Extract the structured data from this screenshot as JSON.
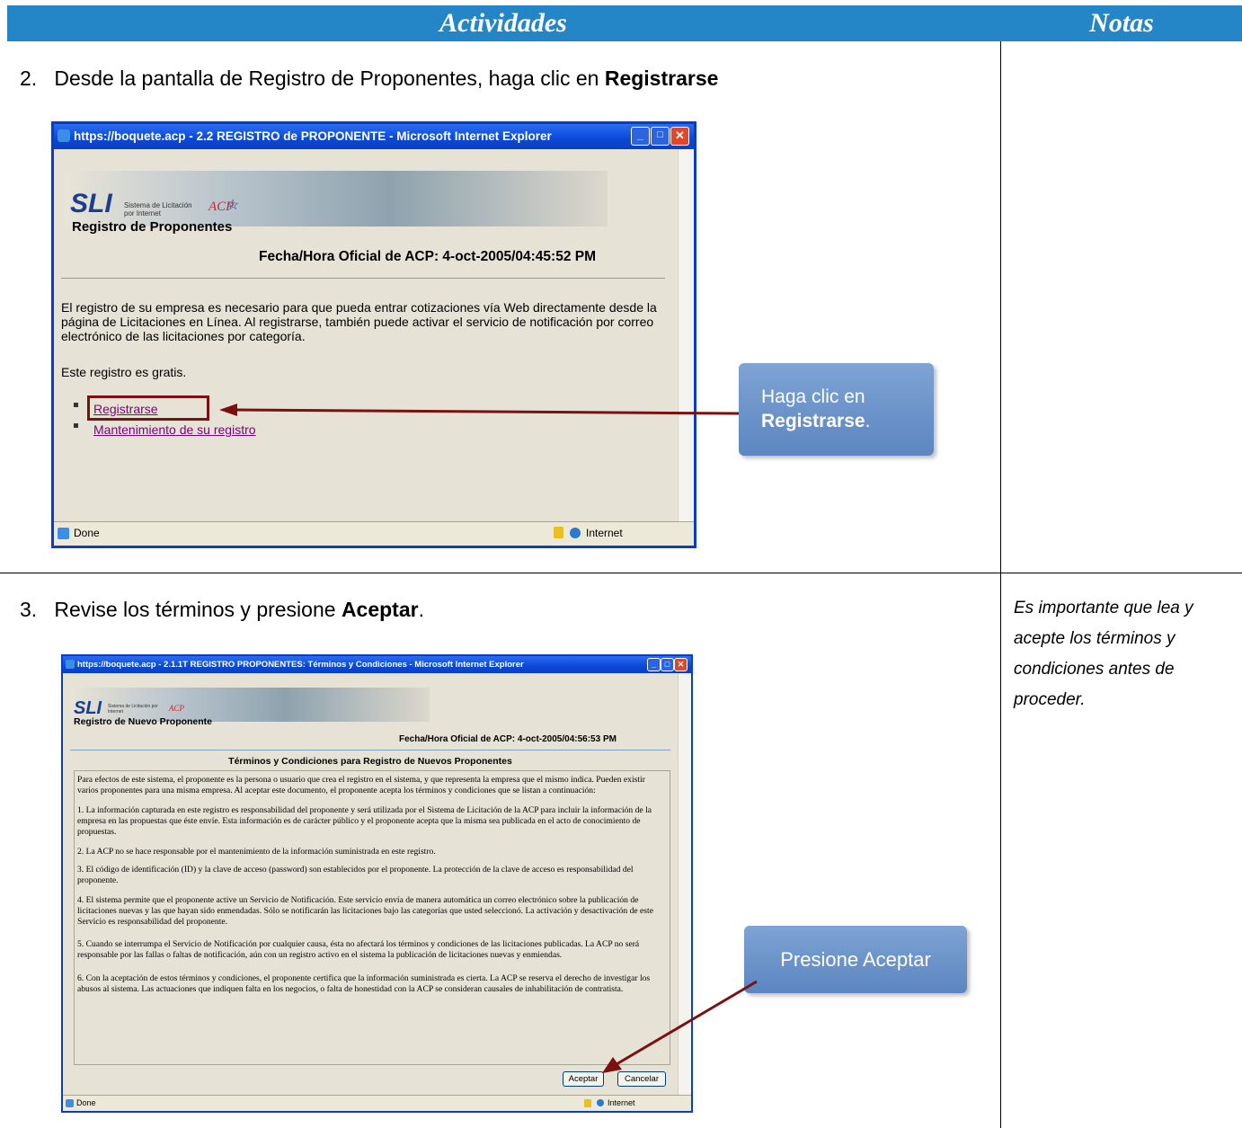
{
  "header": {
    "activities": "Actividades",
    "notes": "Notas"
  },
  "step2": {
    "number": "2.",
    "text": "Desde la pantalla de Registro de Proponentes, haga clic en ",
    "bold": "Registrarse",
    "window": {
      "title": "https://boquete.acp - 2.2 REGISTRO de PROPONENTE - Microsoft Internet Explorer",
      "logo": "SLI",
      "logo_sub": "Sistema de Licitación por Internet",
      "acp": "ACP",
      "page_title": "Registro de Proponentes",
      "datetime": "Fecha/Hora Oficial de ACP: 4-oct-2005/04:45:52 PM",
      "paragraph": "El registro de su empresa es necesario para que pueda entrar cotizaciones vía Web directamente desde la página de Licitaciones en Línea. Al registrarse, también puede activar el servicio de notificación por correo electrónico de las licitaciones por categoría.",
      "free": "Este registro es gratis.",
      "link1": "Registrarse",
      "link2": "Mantenimiento de su registro",
      "status": "Done",
      "zone": "Internet"
    },
    "callout_line1": "Haga clic en",
    "callout_bold": "Registrarse",
    "callout_end": "."
  },
  "step3": {
    "number": "3.",
    "text": "Revise los términos y presione ",
    "bold": "Aceptar",
    "end": ".",
    "window": {
      "title": "https://boquete.acp - 2.1.1T REGISTRO PROPONENTES: Términos y Condiciones - Microsoft Internet Explorer",
      "logo": "SLI",
      "logo_sub": "Sistema de Licitación por Internet",
      "acp": "ACP",
      "page_title": "Registro de Nuevo Proponente",
      "datetime": "Fecha/Hora Oficial de ACP: 4-oct-2005/04:56:53 PM",
      "terms_title": "Términos y Condiciones para Registro de Nuevos Proponentes",
      "intro": "Para efectos de este sistema, el proponente es la persona o usuario que crea el registro en el sistema, y que representa la empresa que el mismo indica. Pueden existir varios proponentes para una misma empresa. Al aceptar este documento, el proponente acepta los términos y condiciones que se listan a continuación:",
      "t1": "1. La información capturada en este registro es responsabilidad del proponente y será utilizada por el Sistema de Licitación de la ACP para incluir la información de la empresa en las propuestas que éste envíe. Esta información es de carácter público y el proponente acepta que la misma sea publicada en el acto de conocimiento de propuestas.",
      "t2": "2. La ACP no se hace responsable por el mantenimiento de la información suministrada en este registro.",
      "t3": "3. El código de identificación (ID) y la clave de acceso (password) son establecidos por el proponente. La protección de la clave de acceso es responsabilidad del proponente.",
      "t4": "4. El sistema permite que el proponente active un Servicio de Notificación. Este servicio envía de manera automática un correo electrónico sobre la publicación de licitaciones nuevas y las que hayan sido enmendadas. Sólo se notificarán las licitaciones bajo las categorías que usted seleccionó. La activación y desactivación de este Servicio es responsabilidad del proponente.",
      "t5": "5. Cuando se interrumpa el Servicio de Notificación por cualquier causa, ésta no afectará los términos y condiciones de las licitaciones publicadas. La ACP no será responsable por las fallas o faltas de notificación, aún con un registro activo en el sistema la publicación de licitaciones nuevas y enmiendas.",
      "t6": "6. Con la aceptación de estos términos y condiciones, el proponente certifica que la información suministrada es cierta. La ACP se reserva el derecho de investigar los abusos al sistema. Las actuaciones que indiquen falta en los negocios, o falta de honestidad con la ACP se consideran causales de inhabilitación de contratista.",
      "accept": "Aceptar",
      "cancel": "Cancelar",
      "status": "Done",
      "zone": "Internet"
    },
    "callout": "Presione Aceptar",
    "note": "Es importante que lea y acepte los términos y condiciones antes de proceder."
  },
  "colors": {
    "header": "#2485c7",
    "callout": "#6a93c9",
    "arrow": "#7b1010",
    "link": "#800080"
  }
}
